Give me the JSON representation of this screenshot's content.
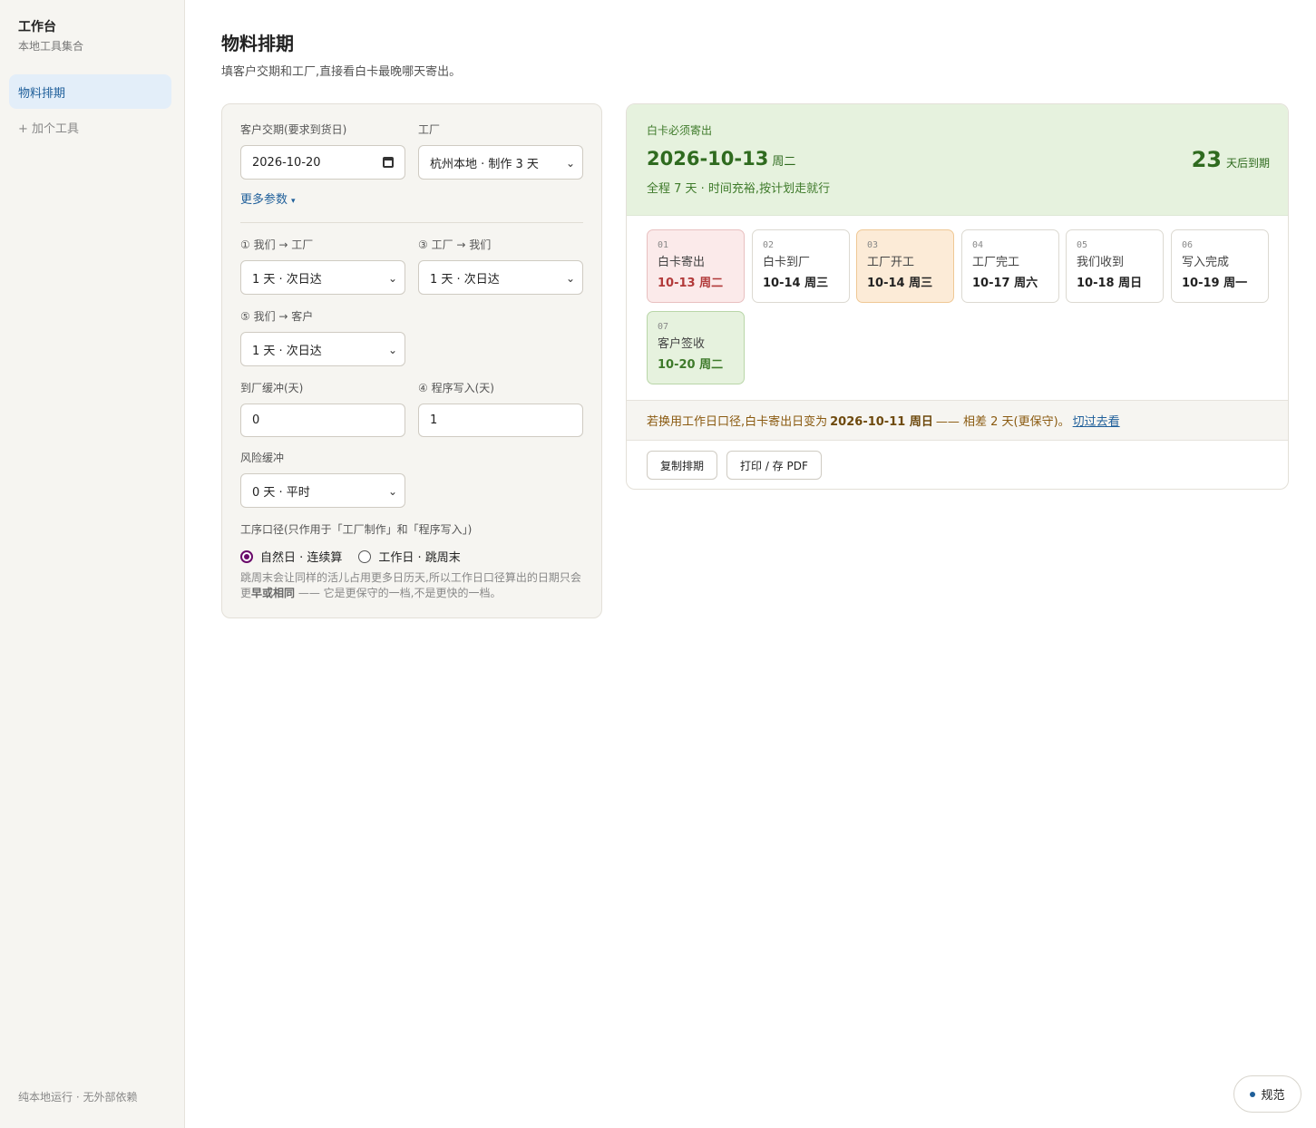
{
  "sidebar": {
    "title": "工作台",
    "subtitle": "本地工具集合",
    "active_item": "物料排期",
    "add_tool": "+ 加个工具",
    "footer": "纯本地运行 · 无外部依赖"
  },
  "header": {
    "title": "物料排期",
    "description": "填客户交期和工厂,直接看白卡最晚哪天寄出。"
  },
  "form": {
    "due_label": "客户交期(要求到货日)",
    "due_value": "2026-10-20",
    "factory_label": "工厂",
    "factory_value": "杭州本地 · 制作 3 天",
    "more_params": "更多参数",
    "leg1_label": "① 我们 → 工厂",
    "leg1_value": "1 天 · 次日达",
    "leg3_label": "③ 工厂 → 我们",
    "leg3_value": "1 天 · 次日达",
    "leg5_label": "⑤ 我们 → 客户",
    "leg5_value": "1 天 · 次日达",
    "buffer_label": "到厂缓冲(天)",
    "buffer_value": "0",
    "write_label": "④ 程序写入(天)",
    "write_value": "1",
    "risk_label": "风险缓冲",
    "risk_value": "0 天 · 平时",
    "mode_label": "工序口径(只作用于「工厂制作」和「程序写入」)",
    "mode_natural": "自然日 · 连续算",
    "mode_workday": "工作日 · 跳周末",
    "hint_a": "跳周末会让同样的活儿占用更多日历天,所以工作日口径算出的日期只会更",
    "hint_b": "早或相同",
    "hint_c": " —— 它是更保守的一档,不是更快的一档。"
  },
  "result": {
    "label": "白卡必须寄出",
    "date": "2026-10-13",
    "weekday": "周二",
    "note": "全程 7 天 · 时间充裕,按计划走就行",
    "days_num": "23",
    "days_unit": "天后到期",
    "steps": [
      {
        "num": "01",
        "name": "白卡寄出",
        "date": "10-13 周二"
      },
      {
        "num": "02",
        "name": "白卡到厂",
        "date": "10-14 周三"
      },
      {
        "num": "03",
        "name": "工厂开工",
        "date": "10-14 周三"
      },
      {
        "num": "04",
        "name": "工厂完工",
        "date": "10-17 周六"
      },
      {
        "num": "05",
        "name": "我们收到",
        "date": "10-18 周日"
      },
      {
        "num": "06",
        "name": "写入完成",
        "date": "10-19 周一"
      },
      {
        "num": "07",
        "name": "客户签收",
        "date": "10-20 周二"
      }
    ],
    "alt_prefix": "若换用工作日口径,白卡寄出日变为",
    "alt_date": "2026-10-11 周日",
    "alt_suffix": "—— 相差 2 天(更保守)。",
    "alt_link": "切过去看",
    "copy_button": "复制排期",
    "print_button": "打印 / 存 PDF"
  },
  "fab": {
    "label": "规范"
  },
  "colors": {
    "accent": "#1f5f9a",
    "success": "#2f6b1f",
    "danger": "#b23a3a",
    "warning": "#8a5a10"
  }
}
